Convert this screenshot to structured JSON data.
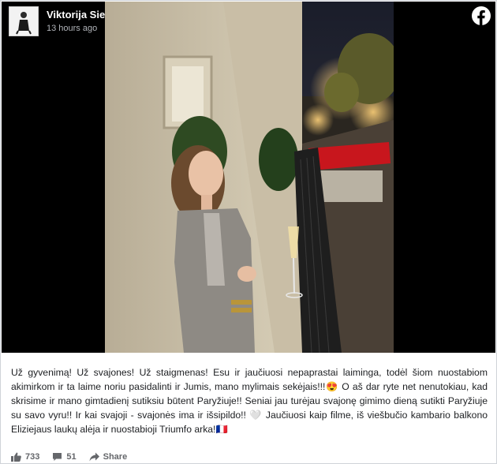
{
  "post": {
    "author": "Viktorija Siegel - Suodaitė",
    "timestamp": "13 hours ago",
    "caption": "Už gyvenimą! Už svajones! Už staigmenas! Esu ir jaučiuosi nepaprastai laiminga, todėl šiom nuostabiom akimirkom ir ta laime noriu pasidalinti ir Jumis, mano mylimais sekėjais!!!😍 O aš dar ryte net nenutokiau, kad skrisime ir mano gimtadienį sutiksiu būtent Paryžiuje!! Seniai jau turėjau svajonę gimimo dieną sutikti Paryžiuje su savo vyru!! Ir kai svajoji - svajonės ima ir išsipildo!! 🤍 Jaučiuosi kaip filme, iš viešbučio kambario balkono Eliziejaus laukų alėja ir nuostabioji Triumfo arka!🇫🇷"
  },
  "actions": {
    "likes": "733",
    "comments": "51",
    "share_label": "Share"
  },
  "icons": {
    "logo": "facebook-icon",
    "like": "thumbs-up-icon",
    "comment": "comment-icon",
    "share": "share-arrow-icon"
  },
  "colors": {
    "brand": "#ffffff",
    "text": "#1c1e21",
    "muted": "#65676b",
    "awning": "#c8161d"
  }
}
